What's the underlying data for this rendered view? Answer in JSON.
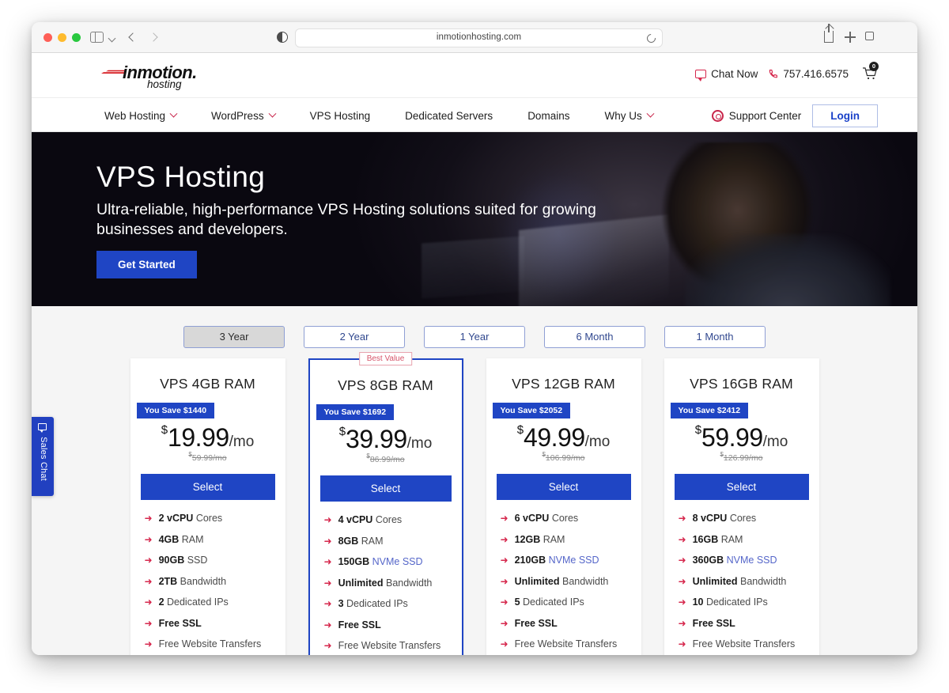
{
  "browser": {
    "address": "inmotionhosting.com",
    "icons": {
      "sidebar": "sidebar-toggle-icon",
      "back": "back-arrow-icon",
      "forward": "forward-arrow-icon",
      "privacy": "privacy-shield-icon",
      "reload": "reload-icon",
      "share": "share-icon",
      "new_tab": "plus-icon",
      "tabs": "tabs-overview-icon"
    }
  },
  "site_header": {
    "logo_word": "inmotion.",
    "logo_sub": "hosting",
    "chat_now": "Chat Now",
    "phone": "757.416.6575",
    "cart_count": "0"
  },
  "nav": {
    "items": [
      {
        "label": "Web Hosting",
        "caret": true
      },
      {
        "label": "WordPress",
        "caret": true
      },
      {
        "label": "VPS Hosting",
        "caret": false
      },
      {
        "label": "Dedicated Servers",
        "caret": false
      },
      {
        "label": "Domains",
        "caret": false
      },
      {
        "label": "Why Us",
        "caret": true
      }
    ],
    "support_center": "Support Center",
    "login": "Login"
  },
  "hero": {
    "title": "VPS Hosting",
    "subtitle": "Ultra-reliable, high-performance VPS Hosting solutions suited for growing businesses and developers.",
    "cta": "Get Started"
  },
  "terms": {
    "options": [
      "3 Year",
      "2 Year",
      "1 Year",
      "6 Month",
      "1 Month"
    ],
    "selected": "3 Year"
  },
  "plans": [
    {
      "title": "VPS 4GB RAM",
      "badge": "You Save $1440",
      "best_value": null,
      "currency": "$",
      "price": "19.99",
      "per": "/mo",
      "old_price": "59.99/mo",
      "cta": "Select",
      "features": [
        {
          "value": "2 vCPU",
          "rest": " Cores",
          "highlight": false
        },
        {
          "value": "4GB",
          "rest": " RAM",
          "highlight": false
        },
        {
          "value": "90GB",
          "rest": " SSD",
          "highlight": false
        },
        {
          "value": "2TB",
          "rest": " Bandwidth",
          "highlight": false
        },
        {
          "value": "2",
          "rest": " Dedicated IPs",
          "highlight": false
        },
        {
          "value": "Free SSL",
          "rest": "",
          "highlight": true
        },
        {
          "value": "",
          "rest": "Free Website Transfers",
          "highlight": false
        }
      ]
    },
    {
      "title": "VPS 8GB RAM",
      "badge": "You Save $1692",
      "best_value": "Best Value",
      "currency": "$",
      "price": "39.99",
      "per": "/mo",
      "old_price": "86.99/mo",
      "cta": "Select",
      "features": [
        {
          "value": "4 vCPU",
          "rest": " Cores",
          "highlight": false
        },
        {
          "value": "8GB",
          "rest": " RAM",
          "highlight": false
        },
        {
          "value": "150GB",
          "rest": " NVMe SSD",
          "highlight": false,
          "rest_blue": true
        },
        {
          "value": "Unlimited",
          "rest": " Bandwidth",
          "highlight": false,
          "value_blue": true
        },
        {
          "value": "3",
          "rest": " Dedicated IPs",
          "highlight": false
        },
        {
          "value": "Free SSL",
          "rest": "",
          "highlight": true
        },
        {
          "value": "",
          "rest": "Free Website Transfers",
          "highlight": false
        }
      ]
    },
    {
      "title": "VPS 12GB RAM",
      "badge": "You Save $2052",
      "best_value": null,
      "currency": "$",
      "price": "49.99",
      "per": "/mo",
      "old_price": "106.99/mo",
      "cta": "Select",
      "features": [
        {
          "value": "6 vCPU",
          "rest": " Cores",
          "highlight": false
        },
        {
          "value": "12GB",
          "rest": " RAM",
          "highlight": false
        },
        {
          "value": "210GB",
          "rest": " NVMe SSD",
          "highlight": false,
          "rest_blue": true
        },
        {
          "value": "Unlimited",
          "rest": " Bandwidth",
          "highlight": false,
          "value_blue": true
        },
        {
          "value": "5",
          "rest": " Dedicated IPs",
          "highlight": false
        },
        {
          "value": "Free SSL",
          "rest": "",
          "highlight": true
        },
        {
          "value": "",
          "rest": "Free Website Transfers",
          "highlight": false
        }
      ]
    },
    {
      "title": "VPS 16GB RAM",
      "badge": "You Save $2412",
      "best_value": null,
      "currency": "$",
      "price": "59.99",
      "per": "/mo",
      "old_price": "126.99/mo",
      "cta": "Select",
      "features": [
        {
          "value": "8 vCPU",
          "rest": " Cores",
          "highlight": false
        },
        {
          "value": "16GB",
          "rest": " RAM",
          "highlight": false
        },
        {
          "value": "360GB",
          "rest": " NVMe SSD",
          "highlight": false,
          "rest_blue": true
        },
        {
          "value": "Unlimited",
          "rest": " Bandwidth",
          "highlight": false,
          "value_blue": true
        },
        {
          "value": "10",
          "rest": " Dedicated IPs",
          "highlight": false
        },
        {
          "value": "Free SSL",
          "rest": "",
          "highlight": true
        },
        {
          "value": "",
          "rest": "Free Website Transfers",
          "highlight": false
        }
      ]
    }
  ],
  "sales_chat": {
    "label": "Sales Chat"
  },
  "colors": {
    "brand_blue": "#1f45c4",
    "brand_red": "#d6274c",
    "accent_border": "#8f9fd4"
  }
}
